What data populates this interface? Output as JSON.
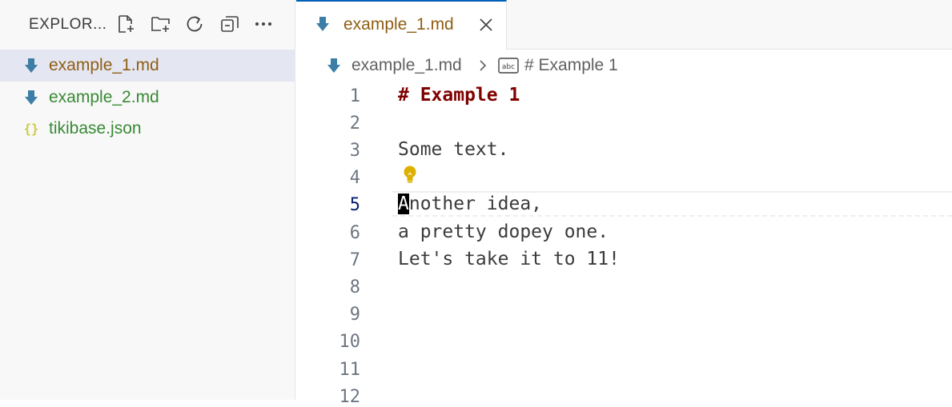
{
  "sidebar": {
    "title": "EXPLOR...",
    "actions": [
      {
        "icon": "new-file-icon"
      },
      {
        "icon": "new-folder-icon"
      },
      {
        "icon": "refresh-icon"
      },
      {
        "icon": "collapse-all-icon"
      },
      {
        "icon": "more-icon"
      }
    ],
    "files": [
      {
        "name": "example_1.md",
        "icon": "markdown-icon",
        "color": "#8f5e15",
        "selected": true
      },
      {
        "name": "example_2.md",
        "icon": "markdown-icon",
        "color": "#388a34",
        "selected": false
      },
      {
        "name": "tikibase.json",
        "icon": "json-braces-icon",
        "color": "#388a34",
        "selected": false
      }
    ]
  },
  "tab": {
    "name": "example_1.md",
    "icon": "markdown-icon",
    "close_icon": "close-icon"
  },
  "breadcrumb": {
    "file": "example_1.md",
    "symbol_icon": "string-symbol-icon",
    "heading": "# Example 1"
  },
  "editor": {
    "active_line": 5,
    "lines": [
      {
        "num": "1",
        "text": "# Example 1"
      },
      {
        "num": "2",
        "text": ""
      },
      {
        "num": "3",
        "text": "Some text."
      },
      {
        "num": "4",
        "text": ""
      },
      {
        "num": "5",
        "cursor_char": "A",
        "text": "nother idea,"
      },
      {
        "num": "6",
        "text": "a pretty dopey one."
      },
      {
        "num": "7",
        "text": "Let's take it to 11!"
      },
      {
        "num": "8",
        "text": ""
      },
      {
        "num": "9",
        "text": ""
      },
      {
        "num": "10",
        "text": ""
      },
      {
        "num": "11",
        "text": ""
      },
      {
        "num": "12",
        "text": ""
      }
    ],
    "lightbulb_icon": "lightbulb-icon"
  },
  "colors": {
    "markdown_icon": "#3d7ea6",
    "json_icon": "#cbcb41",
    "heading": "#800000",
    "accent": "#005fb8",
    "lightbulb": "#ddb100"
  }
}
